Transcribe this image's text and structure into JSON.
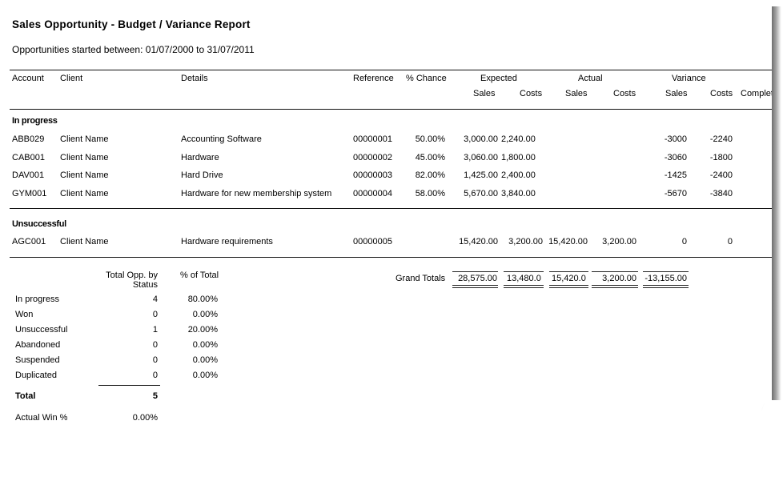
{
  "report": {
    "title": "Sales Opportunity - Budget / Variance Report",
    "subtitle": "Opportunities started between: 01/07/2000 to 31/07/2011"
  },
  "columns": {
    "account": "Account",
    "client": "Client",
    "details": "Details",
    "reference": "Reference",
    "chance": "% Chance",
    "expected": "Expected",
    "actual": "Actual",
    "variance": "Variance",
    "sales": "Sales",
    "costs": "Costs",
    "complete": "Complet"
  },
  "groups": [
    {
      "name": "In progress",
      "rows": [
        {
          "account": "ABB029",
          "client": "Client Name",
          "details": "Accounting Software",
          "reference": "00000001",
          "chance": "50.00%",
          "exp_sales": "3,000.00",
          "exp_costs": "2,240.00",
          "act_sales": "",
          "act_costs": "",
          "var_sales": "-3000",
          "var_costs": "-2240"
        },
        {
          "account": "CAB001",
          "client": "Client Name",
          "details": "Hardware",
          "reference": "00000002",
          "chance": "45.00%",
          "exp_sales": "3,060.00",
          "exp_costs": "1,800.00",
          "act_sales": "",
          "act_costs": "",
          "var_sales": "-3060",
          "var_costs": "-1800"
        },
        {
          "account": "DAV001",
          "client": "Client Name",
          "details": "Hard Drive",
          "reference": "00000003",
          "chance": "82.00%",
          "exp_sales": "1,425.00",
          "exp_costs": "2,400.00",
          "act_sales": "",
          "act_costs": "",
          "var_sales": "-1425",
          "var_costs": "-2400"
        },
        {
          "account": "GYM001",
          "client": "Client Name",
          "details": "Hardware for new membership system",
          "reference": "00000004",
          "chance": "58.00%",
          "exp_sales": "5,670.00",
          "exp_costs": "3,840.00",
          "act_sales": "",
          "act_costs": "",
          "var_sales": "-5670",
          "var_costs": "-3840"
        }
      ]
    },
    {
      "name": "Unsuccessful",
      "rows": [
        {
          "account": "AGC001",
          "client": "Client Name",
          "details": "Hardware requirements",
          "reference": "00000005",
          "chance": "",
          "exp_sales": "15,420.00",
          "exp_costs": "3,200.00",
          "act_sales": "15,420.00",
          "act_costs": "3,200.00",
          "var_sales": "0",
          "var_costs": "0"
        }
      ]
    }
  ],
  "summary": {
    "col_count_line1": "Total Opp. by",
    "col_count_line2": "Status",
    "col_pct": "% of Total",
    "rows": [
      {
        "status": "In progress",
        "count": "4",
        "pct": "80.00%"
      },
      {
        "status": "Won",
        "count": "0",
        "pct": "0.00%"
      },
      {
        "status": "Unsuccessful",
        "count": "1",
        "pct": "20.00%"
      },
      {
        "status": "Abandoned",
        "count": "0",
        "pct": "0.00%"
      },
      {
        "status": "Suspended",
        "count": "0",
        "pct": "0.00%"
      },
      {
        "status": "Duplicated",
        "count": "0",
        "pct": "0.00%"
      }
    ],
    "total_label": "Total",
    "total_value": "5",
    "win_label": "Actual Win %",
    "win_value": "0.00%"
  },
  "grand_totals": {
    "label": "Grand Totals",
    "values": [
      "28,575.00",
      "13,480.0",
      "15,420.0",
      "3,200.00",
      "-13,155.00"
    ]
  }
}
